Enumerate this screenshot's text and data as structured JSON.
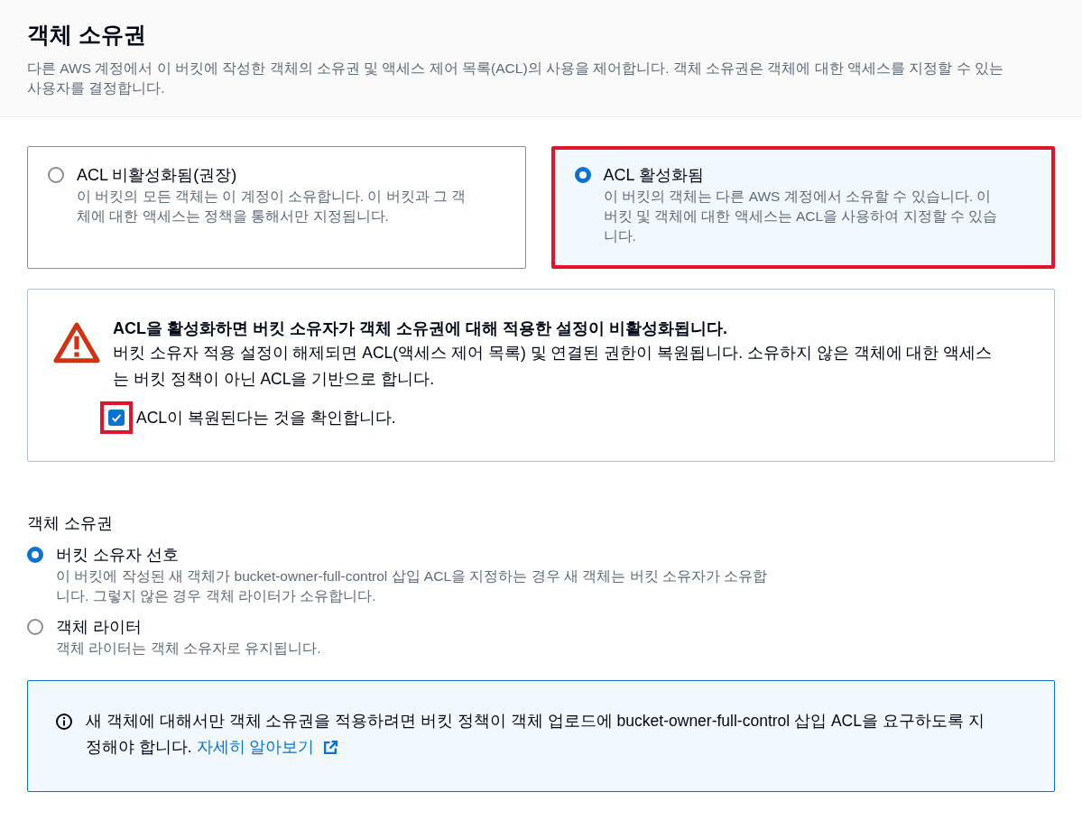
{
  "header": {
    "title": "객체 소유권",
    "description": "다른 AWS 계정에서 이 버킷에 작성한 객체의 소유권 및 액세스 제어 목록(ACL)의 사용을 제어합니다. 객체 소유권은 객체에 대한 액세스를 지정할 수 있는 사용자를 결정합니다."
  },
  "acl_tiles": [
    {
      "label": "ACL 비활성화됨(권장)",
      "description": "이 버킷의 모든 객체는 이 계정이 소유합니다. 이 버킷과 그 객체에 대한 액세스는 정책을 통해서만 지정됩니다.",
      "selected": false,
      "highlighted": false
    },
    {
      "label": "ACL 활성화됨",
      "description": "이 버킷의 객체는 다른 AWS 계정에서 소유할 수 있습니다. 이 버킷 및 객체에 대한 액세스는 ACL을 사용하여 지정할 수 있습니다.",
      "selected": true,
      "highlighted": true
    }
  ],
  "warning": {
    "title": "ACL을 활성화하면 버킷 소유자가 객체 소유권에 대해 적용한 설정이 비활성화됩니다.",
    "body": "버킷 소유자 적용 설정이 해제되면 ACL(액세스 제어 목록) 및 연결된 권한이 복원됩니다. 소유하지 않은 객체에 대한 액세스는 버킷 정책이 아닌 ACL을 기반으로 합니다.",
    "confirm": {
      "label": "ACL이 복원된다는 것을 확인합니다.",
      "checked": true,
      "highlighted": true
    }
  },
  "ownership": {
    "label": "객체 소유권",
    "options": [
      {
        "label": "버킷 소유자 선호",
        "description": "이 버킷에 작성된 새 객체가 bucket-owner-full-control 삽입 ACL을 지정하는 경우 새 객체는 버킷 소유자가 소유합니다. 그렇지 않은 경우 객체 라이터가 소유합니다.",
        "selected": true
      },
      {
        "label": "객체 라이터",
        "description": "객체 라이터는 객체 소유자로 유지됩니다.",
        "selected": false
      }
    ]
  },
  "info": {
    "text": "새 객체에 대해서만 객체 소유권을 적용하려면 버킷 정책이 객체 업로드에 bucket-owner-full-control 삽입 ACL을 요구하도록 지정해야 합니다.",
    "link": "자세히 알아보기"
  }
}
